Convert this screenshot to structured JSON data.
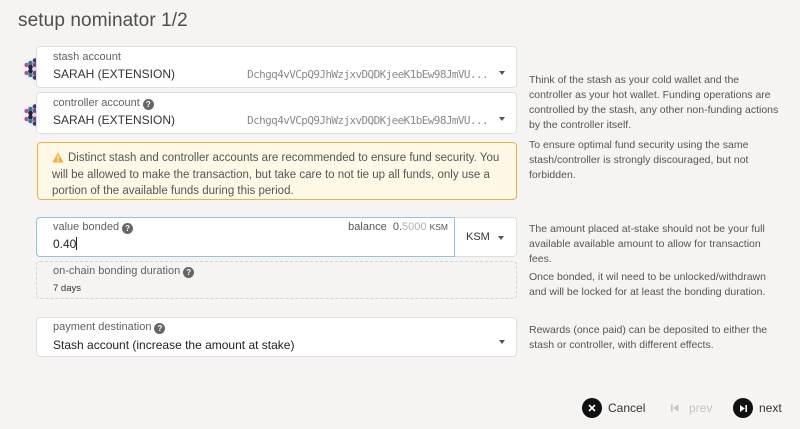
{
  "page": {
    "title": "setup nominator 1/2"
  },
  "stash": {
    "label": "stash account",
    "name": "SARAH (EXTENSION)",
    "address": "Dchgq4vVCpQ9JhWzjxvDQDKjeeK1bEw98JmVU..."
  },
  "controller": {
    "label": "controller account",
    "name": "SARAH (EXTENSION)",
    "address": "Dchgq4vVCpQ9JhWzjxvDQDKjeeK1bEw98JmVU..."
  },
  "help": {
    "stash": "Think of the stash as your cold wallet and the controller as your hot wallet. Funding operations are controlled by the stash, any other non-funding actions by the controller itself.",
    "controller": "To ensure optimal fund security using the same stash/controller is strongly discouraged, but not forbidden.",
    "value": "The amount placed at-stake should not be your full available available amount to allow for transaction fees.",
    "duration": "Once bonded, it wil need to be unlocked/withdrawn and will be locked for at least the bonding duration.",
    "destination": "Rewards (once paid) can be deposited to either the stash or controller, with different effects."
  },
  "warning": {
    "text": "Distinct stash and controller accounts are recommended to ensure fund security. You will be allowed to make the transaction, but take care to not tie up all funds, only use a portion of the available funds during this period."
  },
  "value_bonded": {
    "label": "value bonded",
    "balance_label": "balance",
    "balance_int": "0.",
    "balance_dec": "5000",
    "balance_unit": "KSM",
    "value": "0.40",
    "unit": "KSM"
  },
  "duration": {
    "label": "on-chain bonding duration",
    "value": "7 days"
  },
  "destination": {
    "label": "payment destination",
    "value": "Stash account (increase the amount at stake)"
  },
  "buttons": {
    "cancel": "Cancel",
    "prev": "prev",
    "next": "next"
  },
  "colors": {
    "accent_border": "#8fc3e8",
    "warning_border": "#f3b13a",
    "warning_bg": "#fff8e6"
  }
}
